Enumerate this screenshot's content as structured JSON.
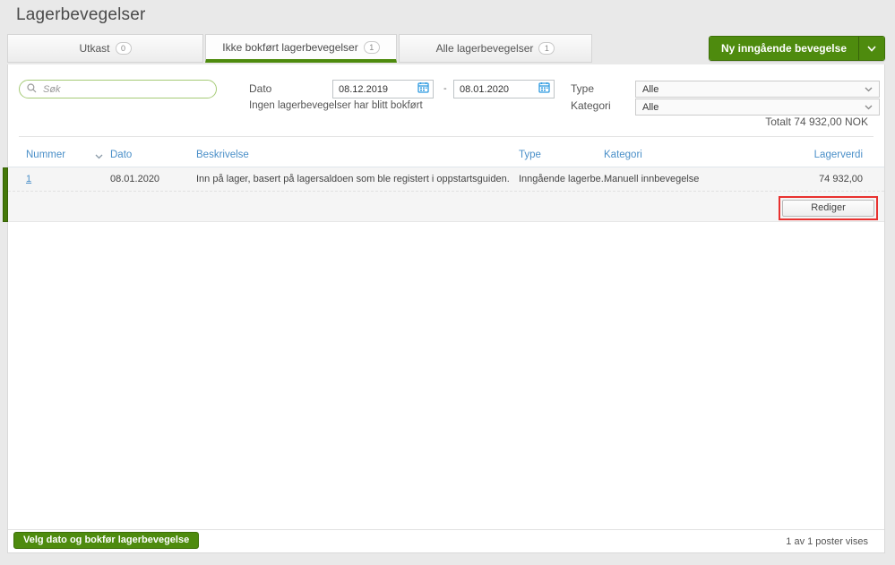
{
  "page": {
    "title": "Lagerbevegelser"
  },
  "tabs": [
    {
      "label": "Utkast",
      "count": "0"
    },
    {
      "label": "Ikke bokført lagerbevegelser",
      "count": "1"
    },
    {
      "label": "Alle lagerbevegelser",
      "count": "1"
    }
  ],
  "actions": {
    "new_movement_label": "Ny inngående bevegelse",
    "edit_button_label": "Rediger",
    "post_button_label": "Velg dato og bokfør lagerbevegelse"
  },
  "filters": {
    "search_placeholder": "Søk",
    "dato_label": "Dato",
    "date_from": "08.12.2019",
    "date_separator": "-",
    "date_to": "08.01.2020",
    "no_posted_note": "Ingen lagerbevegelser har blitt bokført",
    "type_label": "Type",
    "type_value": "Alle",
    "kategori_label": "Kategori",
    "kategori_value": "Alle",
    "total_text": "Totalt 74 932,00 NOK"
  },
  "table": {
    "headers": {
      "nummer": "Nummer",
      "dato": "Dato",
      "beskrivelse": "Beskrivelse",
      "type": "Type",
      "kategori": "Kategori",
      "lagerverdi": "Lagerverdi"
    },
    "rows": [
      {
        "nummer": "1",
        "dato": "08.01.2020",
        "beskrivelse": "Inn på lager, basert på lagersaldoen som ble registert i oppstartsguiden.",
        "type": "Inngående lagerbe...",
        "kategori": "Manuell innbevegelse",
        "lagerverdi": "74 932,00"
      }
    ]
  },
  "footer": {
    "pagination": "1 av 1 poster vises"
  },
  "colors": {
    "accent-green": "#4e8b0e",
    "accent-green-dark": "#3d7007",
    "bar-green": "#447808",
    "link-blue": "#4a8fc8",
    "annotation-red": "#e8312f",
    "icon-blue": "#2e9ae0"
  }
}
